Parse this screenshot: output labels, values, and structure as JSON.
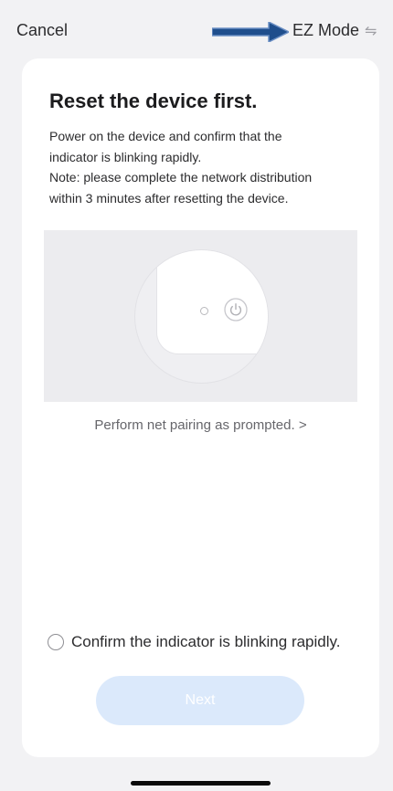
{
  "topbar": {
    "cancel_label": "Cancel",
    "mode_label": "EZ Mode",
    "mode_icon": "swap-arrows-icon",
    "annotation_arrow_color": "#1f4e8c"
  },
  "card": {
    "title": "Reset the device first.",
    "description_lines": [
      "Power on the device and confirm that the",
      "indicator is blinking rapidly.",
      "Note: please complete the network distribution",
      "within 3 minutes after resetting the device."
    ],
    "illustration": {
      "device_icons": [
        "indicator-led-icon",
        "power-icon"
      ]
    },
    "pairing_link": "Perform net pairing as prompted. >",
    "confirm_label": "Confirm the indicator is blinking rapidly.",
    "confirm_checked": false,
    "next_label": "Next",
    "next_enabled": false
  },
  "colors": {
    "background": "#f2f2f4",
    "card": "#ffffff",
    "next_button_disabled": "#dbe9fb",
    "text_primary": "#1c1c1e",
    "text_secondary": "#66666b"
  }
}
